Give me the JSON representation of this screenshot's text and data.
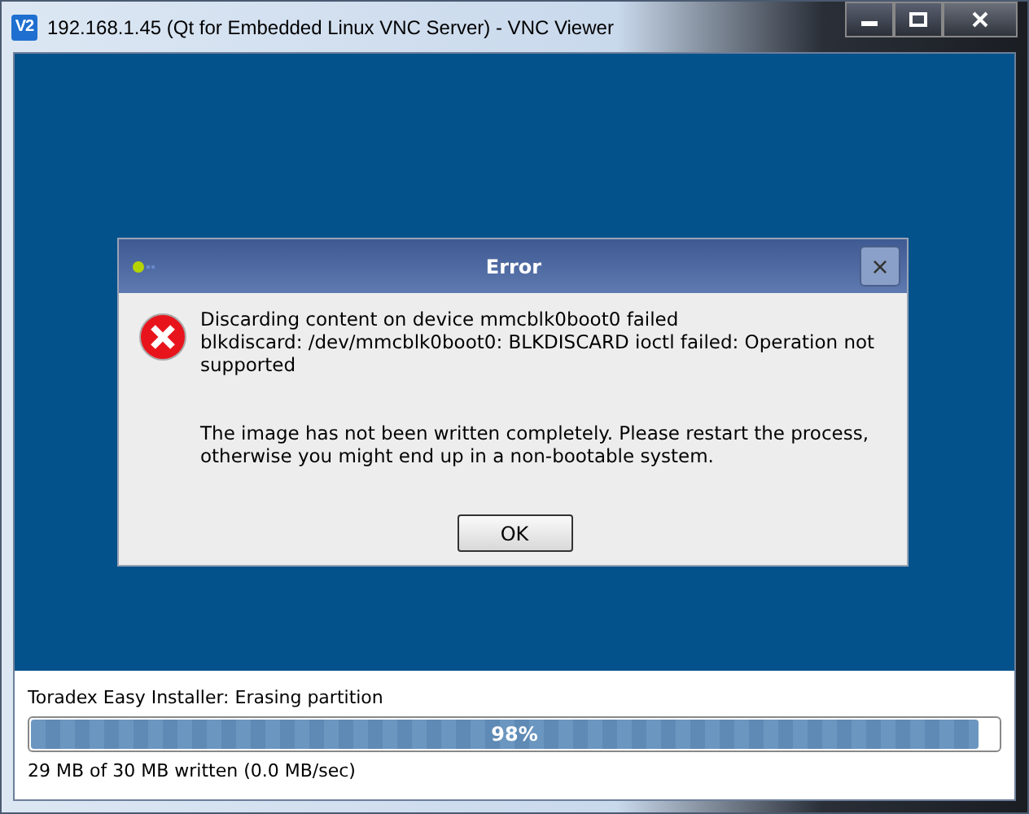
{
  "window": {
    "logo": "V2",
    "title": "192.168.1.45 (Qt for Embedded Linux VNC Server) - VNC Viewer"
  },
  "dialog": {
    "title": "Error",
    "close": "×",
    "message_lines": [
      "Discarding content on device mmcblk0boot0 failed",
      "blkdiscard: /dev/mmcblk0boot0: BLKDISCARD ioctl failed: Operation not supported"
    ],
    "note": "The image has not been written completely. Please restart the process, otherwise you might end up in a non-bootable system.",
    "button": "OK"
  },
  "status": {
    "label": "Toradex Easy Installer: Erasing partition",
    "progress": {
      "level": 0.98,
      "text": "98%"
    },
    "detail": "29 MB of 30 MB written (0.0 MB/sec)"
  }
}
